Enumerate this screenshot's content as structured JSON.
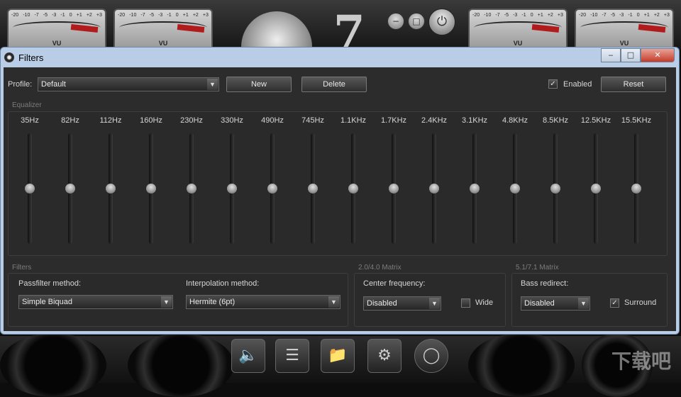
{
  "window": {
    "title": "Filters",
    "minimize": "‒",
    "maximize": "□",
    "close": "✕"
  },
  "profile": {
    "label": "Profile:",
    "value": "Default",
    "new_label": "New",
    "delete_label": "Delete",
    "enabled_label": "Enabled",
    "enabled_checked": true,
    "reset_label": "Reset"
  },
  "equalizer": {
    "title": "Equalizer",
    "bands": [
      {
        "label": "35Hz",
        "level": 0.5
      },
      {
        "label": "82Hz",
        "level": 0.5
      },
      {
        "label": "112Hz",
        "level": 0.5
      },
      {
        "label": "160Hz",
        "level": 0.5
      },
      {
        "label": "230Hz",
        "level": 0.5
      },
      {
        "label": "330Hz",
        "level": 0.5
      },
      {
        "label": "490Hz",
        "level": 0.5
      },
      {
        "label": "745Hz",
        "level": 0.5
      },
      {
        "label": "1.1KHz",
        "level": 0.5
      },
      {
        "label": "1.7KHz",
        "level": 0.5
      },
      {
        "label": "2.4KHz",
        "level": 0.5
      },
      {
        "label": "3.1KHz",
        "level": 0.5
      },
      {
        "label": "4.8KHz",
        "level": 0.5
      },
      {
        "label": "8.5KHz",
        "level": 0.5
      },
      {
        "label": "12.5KHz",
        "level": 0.5
      },
      {
        "label": "15.5KHz",
        "level": 0.5
      }
    ]
  },
  "filters": {
    "title": "Filters",
    "passfilter_label": "Passfilter method:",
    "passfilter_value": "Simple Biquad",
    "interpolation_label": "Interpolation method:",
    "interpolation_value": "Hermite (6pt)"
  },
  "matrix_2_4": {
    "title": "2.0/4.0 Matrix",
    "center_label": "Center frequency:",
    "center_value": "Disabled",
    "wide_label": "Wide",
    "wide_checked": false
  },
  "matrix_5_7": {
    "title": "5.1/7.1 Matrix",
    "bass_label": "Bass redirect:",
    "bass_value": "Disabled",
    "surround_label": "Surround",
    "surround_checked": true
  },
  "background": {
    "vu_label": "VU",
    "vu_scale": [
      "-20",
      "-10",
      "-7",
      "-5",
      "-3",
      "-1",
      "0",
      "+1",
      "+2",
      "+3"
    ],
    "watermark": "下载吧"
  },
  "colors": {
    "dialog_frame": "#b9cde6",
    "client_bg": "#2c2c2c",
    "vu_red": "#b21b1b"
  }
}
